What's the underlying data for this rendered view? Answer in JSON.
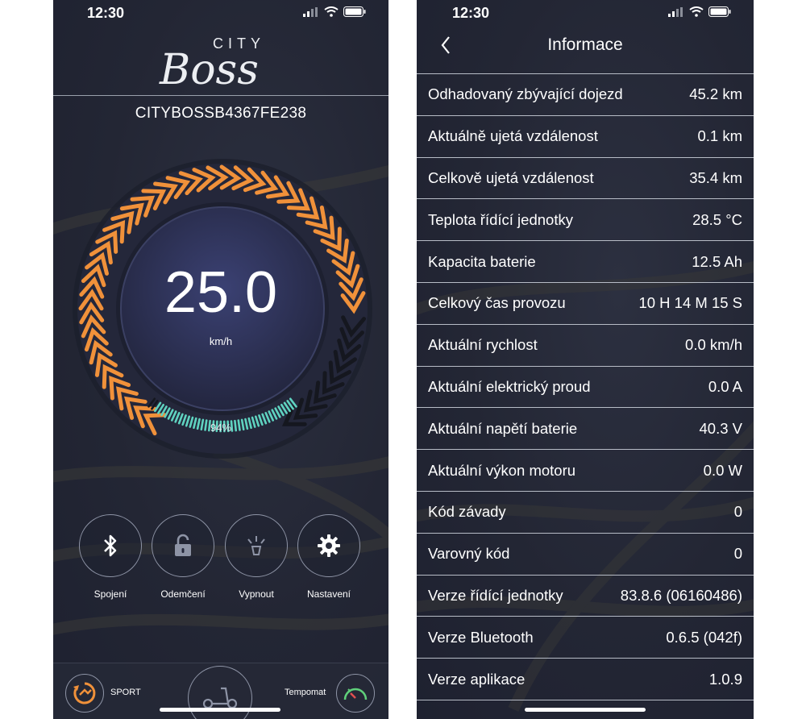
{
  "left": {
    "status": {
      "time": "12:30"
    },
    "logo": {
      "top_text": "CITY",
      "main_text": "Boss"
    },
    "device_id": "CITYBOSSB4367FE238",
    "speed": {
      "value": "25.0",
      "unit": "km/h"
    },
    "battery": {
      "percent_text": "94%",
      "level": 0.94
    },
    "controls": [
      {
        "label": "Spojení",
        "icon": "bluetooth-icon"
      },
      {
        "label": "Odemčení",
        "icon": "unlock-icon"
      },
      {
        "label": "Vypnout",
        "icon": "light-off-icon"
      },
      {
        "label": "Nastavení",
        "icon": "gear-icon"
      }
    ],
    "bottom": {
      "mode_label": "SPORT",
      "cruise_label": "Tempomat"
    },
    "colors": {
      "accent_orange": "#f0913a",
      "battery_teal": "#5fd3c0"
    }
  },
  "right": {
    "status": {
      "time": "12:30"
    },
    "title": "Informace",
    "rows": [
      {
        "label": "Odhadovaný zbývající dojezd",
        "value": "45.2 km"
      },
      {
        "label": "Aktuálně ujetá vzdálenost",
        "value": "0.1 km"
      },
      {
        "label": "Celkově ujetá vzdálenost",
        "value": "35.4 km"
      },
      {
        "label": "Teplota řídící jednotky",
        "value": "28.5 °C"
      },
      {
        "label": "Kapacita baterie",
        "value": "12.5 Ah"
      },
      {
        "label": "Celkový čas provozu",
        "value": "10 H 14 M 15 S"
      },
      {
        "label": "Aktuální rychlost",
        "value": "0.0 km/h"
      },
      {
        "label": "Aktuální elektrický proud",
        "value": "0.0 A"
      },
      {
        "label": "Aktuální napětí baterie",
        "value": "40.3 V"
      },
      {
        "label": "Aktuální výkon motoru",
        "value": "0.0 W"
      },
      {
        "label": "Kód závady",
        "value": "0"
      },
      {
        "label": "Varovný kód",
        "value": "0"
      },
      {
        "label": "Verze řídící jednotky",
        "value": "83.8.6 (06160486)"
      },
      {
        "label": "Verze Bluetooth",
        "value": "0.6.5 (042f)"
      },
      {
        "label": "Verze aplikace",
        "value": "1.0.9"
      }
    ]
  }
}
